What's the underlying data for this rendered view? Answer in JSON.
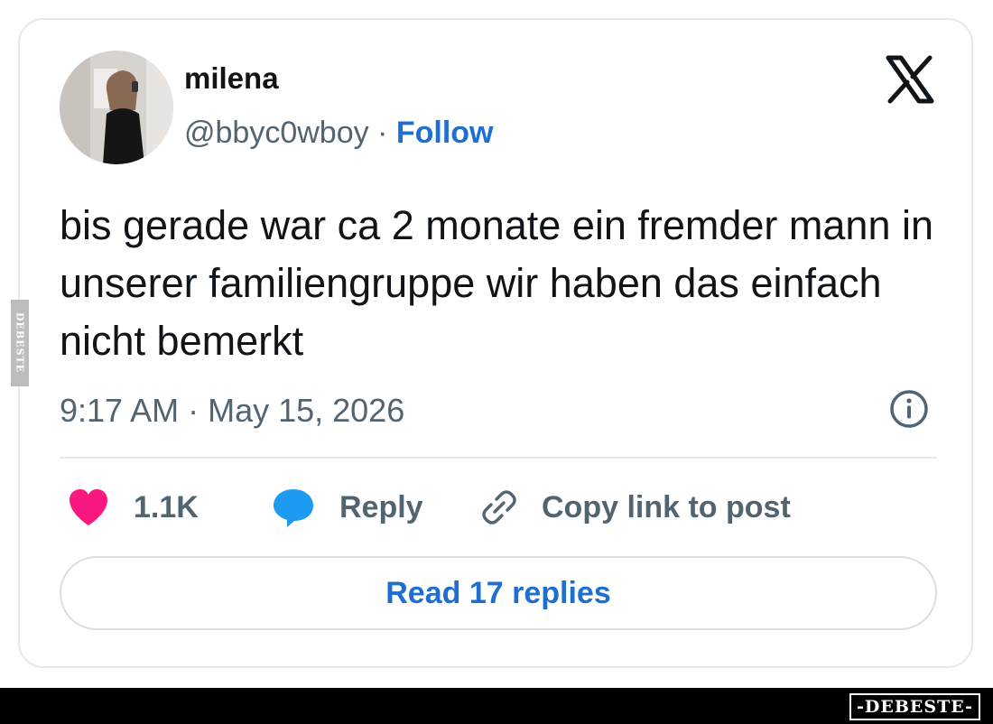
{
  "tweet": {
    "author_name": "milena",
    "handle": "@bbyc0wboy",
    "separator": " · ",
    "follow_label": "Follow",
    "text": "bis gerade war ca 2 monate ein fremder mann in unserer familiengruppe wir haben das einfach nicht bemerkt",
    "timestamp": "9:17 AM · May 15, 2026"
  },
  "actions": {
    "like_count": "1.1K",
    "reply_label": "Reply",
    "copy_label": "Copy link to post"
  },
  "footer": {
    "read_replies_label": "Read 17 replies"
  },
  "watermark": {
    "side_text": "DEBESTE",
    "bottom_text": "-DEBESTE-"
  },
  "icons": {
    "brand": "x-logo-icon",
    "info": "info-icon",
    "like": "heart-icon",
    "reply": "speech-bubble-icon",
    "copy": "link-icon"
  },
  "colors": {
    "accent": "#1d6fd1",
    "heart": "#f91880",
    "reply_bubble": "#1d9bf0",
    "muted_text": "#536471",
    "primary_text": "#0f1419"
  }
}
